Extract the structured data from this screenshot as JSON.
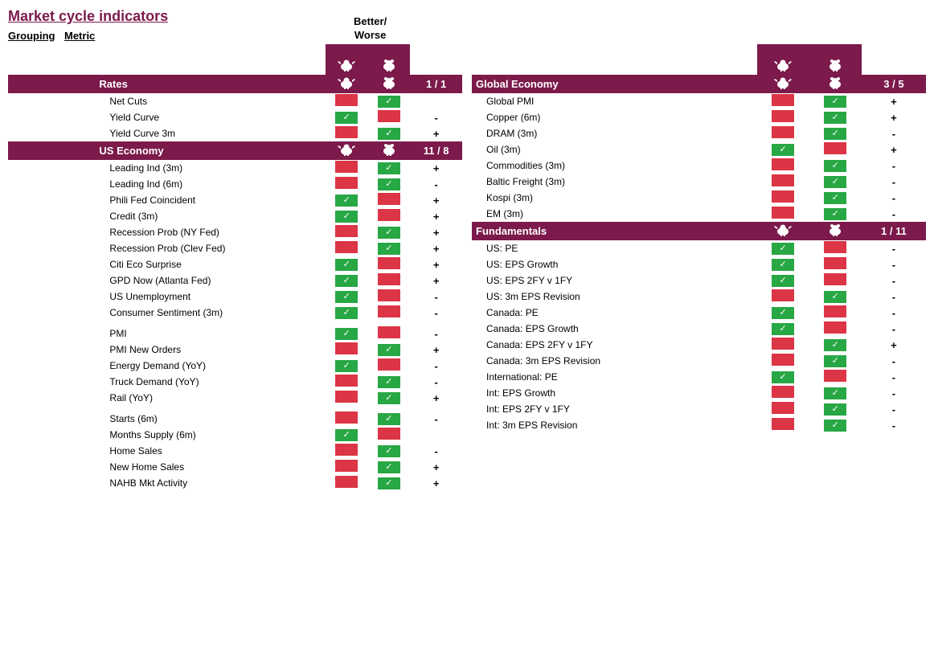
{
  "title": "Market cycle indicators",
  "betterWorse": "Better/\nWorse",
  "headers": {
    "grouping": "Grouping",
    "metric": "Metric"
  },
  "leftPanel": {
    "sections": [
      {
        "name": "Rates",
        "score": "1 / 1",
        "rows": [
          {
            "metric": "Net Cuts",
            "bull": false,
            "bear": true,
            "bw": null
          },
          {
            "metric": "Yield Curve",
            "bull": true,
            "bear": false,
            "bw": "-"
          },
          {
            "metric": "Yield Curve 3m",
            "bull": false,
            "bear": true,
            "bw": "+"
          }
        ]
      },
      {
        "name": "US Economy",
        "score": "11 / 8",
        "rows": [
          {
            "metric": "Leading Ind (3m)",
            "bull": false,
            "bear": true,
            "bw": "+"
          },
          {
            "metric": "Leading Ind (6m)",
            "bull": false,
            "bear": true,
            "bw": "-"
          },
          {
            "metric": "Phili Fed Coincident",
            "bull": true,
            "bear": false,
            "bw": "+"
          },
          {
            "metric": "Credit (3m)",
            "bull": true,
            "bear": false,
            "bw": "+"
          },
          {
            "metric": "Recession Prob (NY Fed)",
            "bull": false,
            "bear": true,
            "bw": "+"
          },
          {
            "metric": "Recession Prob (Clev Fed)",
            "bull": false,
            "bear": true,
            "bw": "+"
          },
          {
            "metric": "Citi Eco Surprise",
            "bull": true,
            "bear": false,
            "bw": "+"
          },
          {
            "metric": "GPD Now (Atlanta Fed)",
            "bull": true,
            "bear": false,
            "bw": "+"
          },
          {
            "metric": "US Unemployment",
            "bull": true,
            "bear": false,
            "bw": "-"
          },
          {
            "metric": "Consumer Sentiment (3m)",
            "bull": true,
            "bear": false,
            "bw": "-"
          },
          {
            "metric": "spacer",
            "bull": null,
            "bear": null,
            "bw": null
          },
          {
            "metric": "PMI",
            "bull": true,
            "bear": false,
            "bw": "-"
          },
          {
            "metric": "PMI New Orders",
            "bull": false,
            "bear": true,
            "bw": "+"
          },
          {
            "metric": "Energy Demand (YoY)",
            "bull": true,
            "bear": false,
            "bw": "-"
          },
          {
            "metric": "Truck Demand (YoY)",
            "bull": false,
            "bear": true,
            "bw": "-"
          },
          {
            "metric": "Rail (YoY)",
            "bull": false,
            "bear": true,
            "bw": "+"
          },
          {
            "metric": "spacer2",
            "bull": null,
            "bear": null,
            "bw": null
          },
          {
            "metric": "Starts (6m)",
            "bull": false,
            "bear": true,
            "bw": "-"
          },
          {
            "metric": "Months Supply (6m)",
            "bull": true,
            "bear": false,
            "bw": null
          },
          {
            "metric": "Home Sales",
            "bull": false,
            "bear": true,
            "bw": "-"
          },
          {
            "metric": "New Home Sales",
            "bull": false,
            "bear": true,
            "bw": "+"
          },
          {
            "metric": "NAHB Mkt Activity",
            "bull": false,
            "bear": true,
            "bw": "+"
          }
        ]
      }
    ]
  },
  "rightPanel": {
    "sections": [
      {
        "name": "Global Economy",
        "score": "3 / 5",
        "rows": [
          {
            "metric": "Global PMI",
            "bull": false,
            "bear": true,
            "bw": "+"
          },
          {
            "metric": "Copper (6m)",
            "bull": false,
            "bear": true,
            "bw": "+"
          },
          {
            "metric": "DRAM (3m)",
            "bull": false,
            "bear": true,
            "bw": "-"
          },
          {
            "metric": "Oil (3m)",
            "bull": true,
            "bear": false,
            "bw": "+"
          },
          {
            "metric": "Commodities (3m)",
            "bull": false,
            "bear": true,
            "bw": "-"
          },
          {
            "metric": "Baltic Freight (3m)",
            "bull": false,
            "bear": true,
            "bw": "-"
          },
          {
            "metric": "Kospi (3m)",
            "bull": false,
            "bear": true,
            "bw": "-"
          },
          {
            "metric": "EM (3m)",
            "bull": false,
            "bear": true,
            "bw": "-"
          }
        ]
      },
      {
        "name": "Fundamentals",
        "score": "1 / 11",
        "rows": [
          {
            "metric": "US: PE",
            "bull": true,
            "bear": false,
            "bw": "-"
          },
          {
            "metric": "US: EPS Growth",
            "bull": true,
            "bear": false,
            "bw": "-"
          },
          {
            "metric": "US: EPS 2FY v 1FY",
            "bull": true,
            "bear": false,
            "bw": "-"
          },
          {
            "metric": "US: 3m EPS Revision",
            "bull": false,
            "bear": true,
            "bw": "-"
          },
          {
            "metric": "Canada: PE",
            "bull": true,
            "bear": false,
            "bw": "-"
          },
          {
            "metric": "Canada: EPS Growth",
            "bull": true,
            "bear": false,
            "bw": "-"
          },
          {
            "metric": "Canada: EPS 2FY v 1FY",
            "bull": false,
            "bear": true,
            "bw": "+"
          },
          {
            "metric": "Canada: 3m EPS Revision",
            "bull": false,
            "bear": true,
            "bw": "-"
          },
          {
            "metric": "International: PE",
            "bull": true,
            "bear": false,
            "bw": "-"
          },
          {
            "metric": "Int: EPS Growth",
            "bull": false,
            "bear": true,
            "bw": "-"
          },
          {
            "metric": "Int: EPS 2FY v 1FY",
            "bull": false,
            "bear": true,
            "bw": "-"
          },
          {
            "metric": "Int: 3m EPS Revision",
            "bull": false,
            "bear": true,
            "bw": "-"
          }
        ]
      }
    ]
  }
}
